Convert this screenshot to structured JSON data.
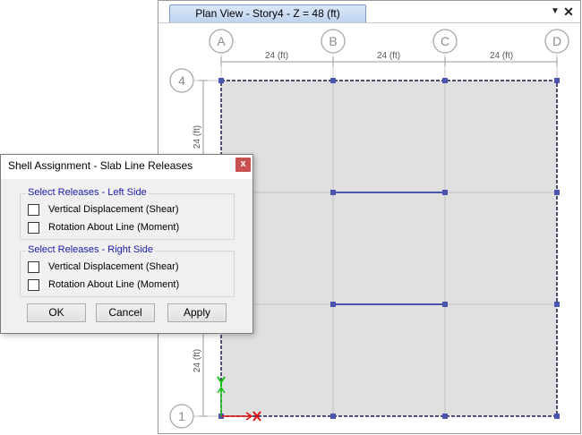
{
  "plan_view": {
    "tab_title": "Plan View - Story4 - Z = 48 (ft)",
    "menu_glyph": "▼",
    "close_glyph": "✕",
    "grid_columns": [
      "A",
      "B",
      "C",
      "D"
    ],
    "grid_rows": [
      "4",
      "1"
    ],
    "dimension_label": "24 (ft)",
    "colors": {
      "slab_fill": "#e0e0e0",
      "grid_line": "#c2c2c2",
      "slab_edge": "#1b1b4e",
      "released_line": "#4a55b0",
      "node": "#4a55b0",
      "axis_x": "#e01010",
      "axis_y": "#10c010"
    }
  },
  "dialog": {
    "title": "Shell Assignment - Slab Line Releases",
    "close_glyph": "x",
    "left_group": {
      "legend": "Select Releases - Left Side",
      "vertical": "Vertical Displacement (Shear)",
      "rotation": "Rotation About Line (Moment)"
    },
    "right_group": {
      "legend": "Select Releases - Right Side",
      "vertical": "Vertical Displacement (Shear)",
      "rotation": "Rotation About Line (Moment)"
    },
    "buttons": {
      "ok": "OK",
      "cancel": "Cancel",
      "apply": "Apply"
    }
  }
}
